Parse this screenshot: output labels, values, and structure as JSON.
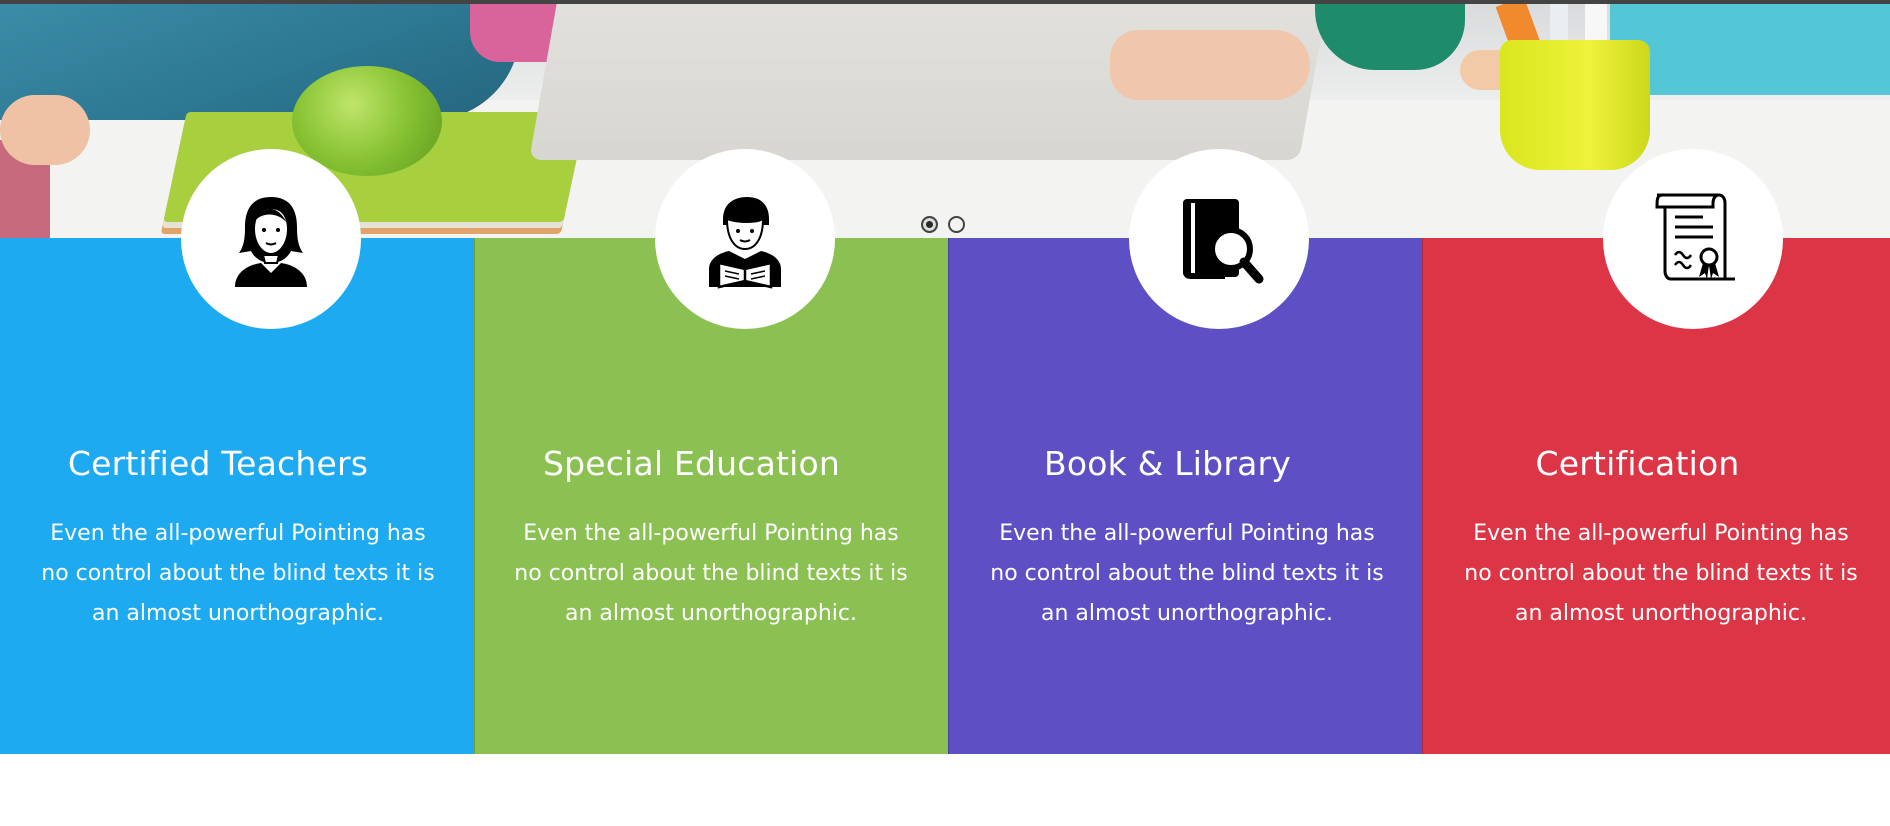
{
  "slider": {
    "dots": [
      {
        "label": "slide-1",
        "active": true
      },
      {
        "label": "slide-2",
        "active": false
      }
    ]
  },
  "features": [
    {
      "title": "Certified Teachers",
      "text": "Even the all-powerful Pointing has no control about the blind texts it is an almost unorthographic.",
      "icon": "teacher-woman-icon",
      "color": "#1eaaf1"
    },
    {
      "title": "Special Education",
      "text": "Even the all-powerful Pointing has no control about the blind texts it is an almost unorthographic.",
      "icon": "student-reading-icon",
      "color": "#8bc152"
    },
    {
      "title": "Book & Library",
      "text": "Even the all-powerful Pointing has no control about the blind texts it is an almost unorthographic.",
      "icon": "book-search-icon",
      "color": "#5d50c5"
    },
    {
      "title": "Certification",
      "text": "Even the all-powerful Pointing has no control about the blind texts it is an almost unorthographic.",
      "icon": "certificate-icon",
      "color": "#dc3545"
    }
  ]
}
